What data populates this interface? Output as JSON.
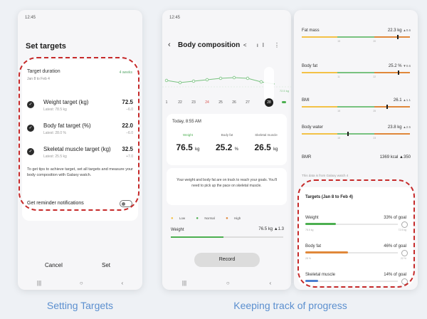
{
  "colors": {
    "accent_green": "#4caf50",
    "accent_orange": "#e0883a",
    "accent_blue": "#4a7fd0",
    "dash_red": "#c62a2a",
    "caption_blue": "#5b8fcf"
  },
  "captions": {
    "left": "Setting Targets",
    "right": "Keeping track of progress"
  },
  "phone_a": {
    "status_time": "12:45",
    "title": "Set targets",
    "duration": {
      "label": "Target duration",
      "range": "Jan 8 to Feb 4",
      "value": "4 weeks"
    },
    "targets": [
      {
        "label": "Weight target (kg)",
        "latest": "Latest: 78.5 kg",
        "value": "72.5",
        "delta": "−6.0"
      },
      {
        "label": "Body fat target (%)",
        "latest": "Latest: 28.0 %",
        "value": "22.0",
        "delta": "−6.0"
      },
      {
        "label": "Skeletal muscle target (kg)",
        "latest": "Latest: 25.5 kg",
        "value": "32.5",
        "delta": "+7.0"
      }
    ],
    "tip": "To get tips to achieve target, set all targets and measure your body composition with Galaxy watch.",
    "reminder_label": "Get reminder notifications",
    "reminder_on": false,
    "cancel_label": "Cancel",
    "set_label": "Set",
    "nav": {
      "recents": "|||",
      "home": "○",
      "back": "‹"
    }
  },
  "phone_b": {
    "status_time": "12:45",
    "back_icon": "‹",
    "title": "Body composition",
    "header_icons": "< ıl ⋮",
    "chart_label": "72.5 kg",
    "days": [
      {
        "label": "1",
        "sunday": false,
        "selected": false
      },
      {
        "label": "22",
        "sunday": false,
        "selected": false
      },
      {
        "label": "23",
        "sunday": false,
        "selected": false
      },
      {
        "label": "24",
        "sunday": true,
        "selected": false
      },
      {
        "label": "25",
        "sunday": false,
        "selected": false
      },
      {
        "label": "26",
        "sunday": false,
        "selected": false
      },
      {
        "label": "27",
        "sunday": false,
        "selected": false
      },
      {
        "label": "28",
        "sunday": false,
        "selected": true
      }
    ],
    "today": "Today, 8:55 AM",
    "metrics": [
      {
        "label": "Weight",
        "value": "76.5",
        "unit": "kg"
      },
      {
        "label": "Body fat",
        "value": "25.2",
        "unit": "%"
      },
      {
        "label": "Skeletal muscle",
        "value": "26.5",
        "unit": "kg"
      }
    ],
    "message": "Your weight and body fat are on track to reach your goals. You'll need to pick up the pace on skeletal muscle.",
    "legend": {
      "low": "Low",
      "normal": "Normal",
      "high": "High"
    },
    "weight_label": "Weight",
    "weight_value": "76.5 kg ▲1.3",
    "weight_level": 0.47,
    "record_label": "Record",
    "nav": {
      "recents": "|||",
      "home": "○",
      "back": "‹"
    }
  },
  "phone_c": {
    "items": [
      {
        "label": "Fat mass",
        "value": "22.3 kg",
        "delta": "▲0.6",
        "marker": 0.88,
        "tick1": "15",
        "tick2": "20"
      },
      {
        "label": "Body fat",
        "value": "25.2 %",
        "delta": "▼0.6",
        "marker": 0.89,
        "tick1": "11",
        "tick2": "22"
      },
      {
        "label": "BMI",
        "value": "26.1",
        "delta": "▲1.1",
        "marker": 0.78,
        "tick1": "15",
        "tick2": "25"
      },
      {
        "label": "Body water",
        "value": "23.8 kg",
        "delta": "▲2.5",
        "marker": 0.42,
        "tick1": "15",
        "tick2": "23"
      }
    ],
    "bmr_label": "BMR",
    "bmr_value": "1369 kcal ▲350",
    "source_note": "This data is from Galaxy watch 4",
    "targets_title": "Targets (Jan 8 to Feb 4)",
    "goals": [
      {
        "label": "Weight",
        "pct_text": "33% of goal",
        "progress": 0.33,
        "color": "#4caf50",
        "lo": "78.5 kg",
        "hi": "72.5 kg"
      },
      {
        "label": "Body fat",
        "pct_text": "46% of goal",
        "progress": 0.46,
        "color": "#e0883a",
        "lo": "28 %",
        "hi": "22 %"
      },
      {
        "label": "Skeletal muscle",
        "pct_text": "14% of goal",
        "progress": 0.14,
        "color": "#4a7fd0",
        "lo": "",
        "hi": ""
      }
    ]
  }
}
